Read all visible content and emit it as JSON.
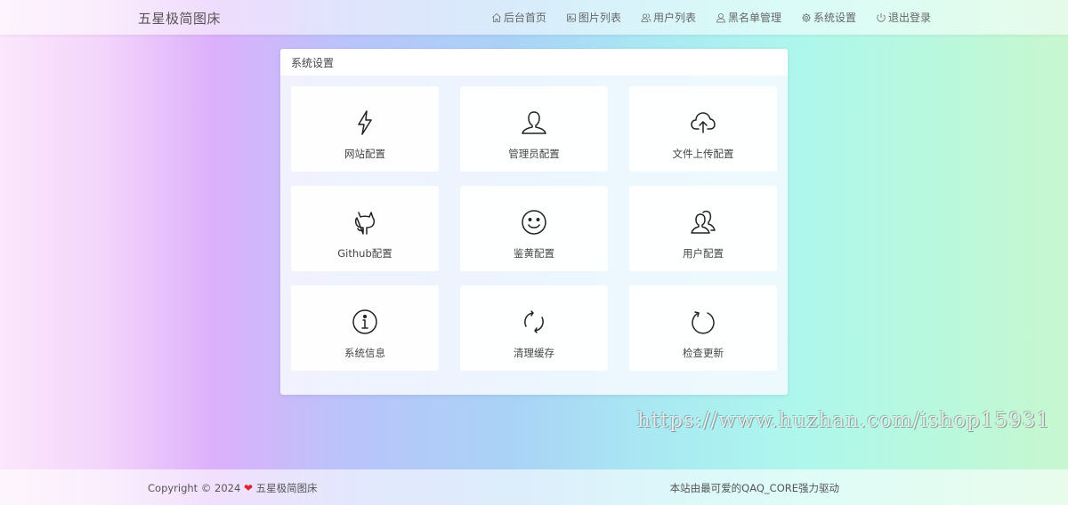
{
  "header": {
    "brand": "五星极简图床",
    "nav": [
      {
        "label": "后台首页",
        "icon": "home-icon"
      },
      {
        "label": "图片列表",
        "icon": "image-icon"
      },
      {
        "label": "用户列表",
        "icon": "users-icon"
      },
      {
        "label": "黑名单管理",
        "icon": "user-icon"
      },
      {
        "label": "系统设置",
        "icon": "gear-icon"
      },
      {
        "label": "退出登录",
        "icon": "power-icon"
      }
    ]
  },
  "panel": {
    "title": "系统设置",
    "cards": [
      {
        "label": "网站配置",
        "icon": "lightning-icon"
      },
      {
        "label": "管理员配置",
        "icon": "user-icon"
      },
      {
        "label": "文件上传配置",
        "icon": "cloud-upload-icon"
      },
      {
        "label": "Github配置",
        "icon": "github-icon"
      },
      {
        "label": "鉴黄配置",
        "icon": "smile-icon"
      },
      {
        "label": "用户配置",
        "icon": "users-icon"
      },
      {
        "label": "系统信息",
        "icon": "info-icon"
      },
      {
        "label": "清理缓存",
        "icon": "sync-icon"
      },
      {
        "label": "检查更新",
        "icon": "refresh-icon"
      }
    ]
  },
  "watermark": "https://www.huzhan.com/ishop15931",
  "footer": {
    "copyright_prefix": "Copyright © 2024",
    "copyright_name": "五星极简图床",
    "powered": "本站由最可爱的QAQ_CORE强力驱动"
  },
  "colors": {
    "heart": "#e0242f"
  }
}
